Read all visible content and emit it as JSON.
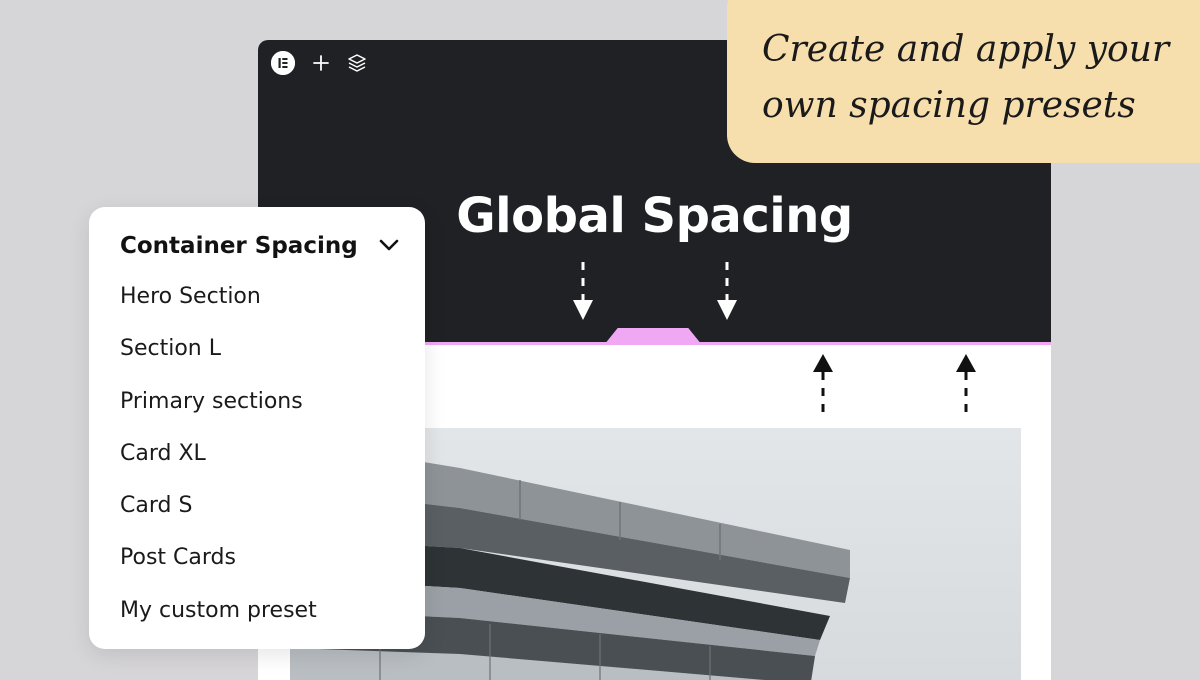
{
  "callout": {
    "line1": "Create and apply your",
    "line2": "own spacing presets"
  },
  "editor": {
    "toolbar": {
      "logo_icon": "elementor-logo-icon",
      "add_icon": "plus-icon",
      "layers_icon": "layers-icon"
    },
    "heading": "Global Spacing"
  },
  "dropdown": {
    "title": "Container Spacing",
    "chevron_icon": "chevron-down-icon",
    "items": [
      "Hero Section",
      "Section L",
      "Primary sections",
      "Card XL",
      "Card S",
      "Post Cards",
      "My custom preset"
    ]
  },
  "colors": {
    "editor_dark": "#1f2124",
    "accent_pink": "#f0a8f4",
    "callout_bg": "#f7dfad",
    "page_bg": "#d6d5d8"
  }
}
